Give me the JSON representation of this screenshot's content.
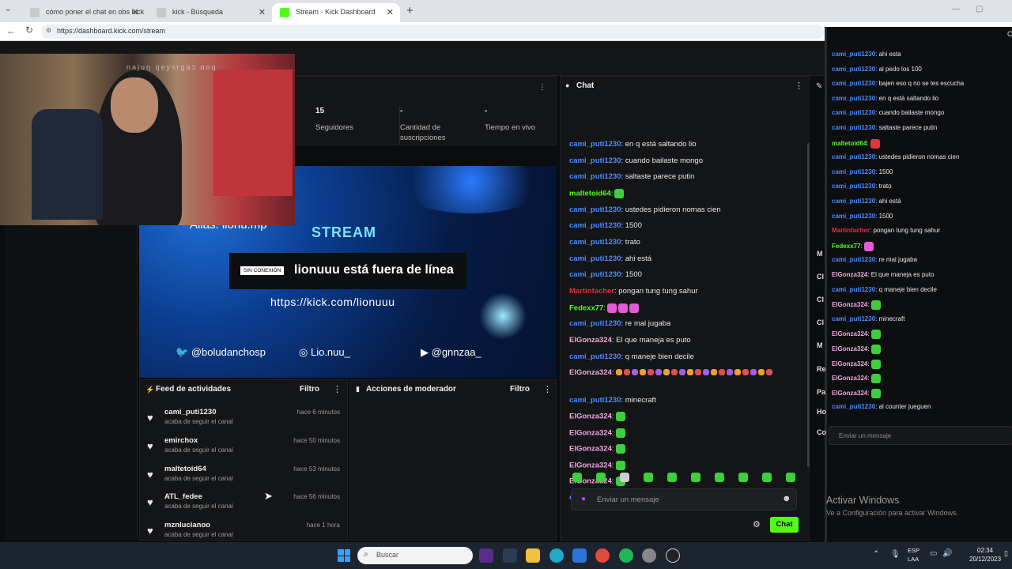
{
  "browser": {
    "tabs": [
      {
        "label": "cómo poner el chat en obs kick - B"
      },
      {
        "label": "kick - Búsqueda"
      },
      {
        "label": "Stream - Kick Dashboard"
      }
    ],
    "url": "https://dashboard.kick.com/stream"
  },
  "stats": [
    {
      "num": "15",
      "label": "Seguidores"
    },
    {
      "num": "-",
      "label": "Cantidad de suscripciones"
    },
    {
      "num": "-",
      "label": "Tiempo en vivo"
    }
  ],
  "banner": {
    "alias": "Alias: lionu.mp",
    "stream_word": "STREAM",
    "offline_badge": "SIN CONEXIÓN",
    "offline_text": "lionuuu está fuera de línea",
    "link": "https://kick.com/lionuuu",
    "social_twitter": "@boludanchosp",
    "social_instagram": "Lio.nuu_",
    "social_youtube": "@gnnzaa_"
  },
  "webcam": {
    "overlay_text": "najuŋ qeysrgaɔ ɑoq"
  },
  "activity_feed": {
    "title": "Feed de actividades",
    "filter": "Filtro",
    "items": [
      {
        "name": "cami_puti1230",
        "desc": "acaba de seguir el canal",
        "time": "hace 6 minutos"
      },
      {
        "name": "emirchox",
        "desc": "acaba de seguir el canal",
        "time": "hace 50 minutos"
      },
      {
        "name": "maltetoid64",
        "desc": "acaba de seguir el canal",
        "time": "hace 53 minutos"
      },
      {
        "name": "ATL_fedee",
        "desc": "acaba de seguir el canal",
        "time": "hace 56 minutos"
      },
      {
        "name": "mznlucianoo",
        "desc": "acaba de seguir el canal",
        "time": "hace 1 hora"
      }
    ]
  },
  "mod_actions": {
    "title": "Acciones de moderador",
    "filter": "Filtro"
  },
  "chat": {
    "title": "Chat",
    "input_placeholder": "Enviar un mensaje",
    "send_label": "Chat",
    "messages": [
      {
        "user": "cami_puti1230",
        "color": "#4a8cff",
        "text": ": en q está saltando lio",
        "emotes": ""
      },
      {
        "user": "cami_puti1230",
        "color": "#4a8cff",
        "text": ": cuando bailaste mongo",
        "emotes": ""
      },
      {
        "user": "cami_puti1230",
        "color": "#4a8cff",
        "text": ": saltaste parece putin",
        "emotes": ""
      },
      {
        "user": "maltetoid64",
        "color": "#53fc18",
        "text": ":",
        "emotes": "g"
      },
      {
        "user": "cami_puti1230",
        "color": "#4a8cff",
        "text": ": ustedes pidieron nomas cien",
        "emotes": ""
      },
      {
        "user": "cami_puti1230",
        "color": "#4a8cff",
        "text": ": 1500",
        "emotes": ""
      },
      {
        "user": "cami_puti1230",
        "color": "#4a8cff",
        "text": ": trato",
        "emotes": ""
      },
      {
        "user": "cami_puti1230",
        "color": "#4a8cff",
        "text": ": ahi está",
        "emotes": ""
      },
      {
        "user": "cami_puti1230",
        "color": "#4a8cff",
        "text": ": 1500",
        "emotes": ""
      },
      {
        "user": "Martinfacher",
        "color": "#e0303c",
        "text": ": pongan tung tung sahur",
        "emotes": ""
      },
      {
        "user": "Fedexx77",
        "color": "#53fc18",
        "text": ":",
        "emotes": "ppp"
      },
      {
        "user": "cami_puti1230",
        "color": "#4a8cff",
        "text": ": re mal jugaba",
        "emotes": ""
      },
      {
        "user": "ElGonza324",
        "color": "#f0a7e0",
        "text": ": El que maneja es puto",
        "emotes": ""
      },
      {
        "user": "cami_puti1230",
        "color": "#4a8cff",
        "text": ": q maneje bien decile",
        "emotes": ""
      },
      {
        "user": "ElGonza324",
        "color": "#f0a7e0",
        "text": ":",
        "emotes": "rrrrrrrrrrrrrrrrrrrr"
      },
      {
        "user": "cami_puti1230",
        "color": "#4a8cff",
        "text": ": minecraft",
        "emotes": ""
      },
      {
        "user": "ElGonza324",
        "color": "#f0a7e0",
        "text": ":",
        "emotes": "g"
      },
      {
        "user": "ElGonza324",
        "color": "#f0a7e0",
        "text": ":",
        "emotes": "g"
      },
      {
        "user": "ElGonza324",
        "color": "#f0a7e0",
        "text": ":",
        "emotes": "g"
      },
      {
        "user": "ElGonza324",
        "color": "#f0a7e0",
        "text": ":",
        "emotes": "g"
      },
      {
        "user": "ElGonza324",
        "color": "#f0a7e0",
        "text": ":",
        "emotes": "g"
      },
      {
        "user": "cami_puti1230",
        "color": "#4a8cff",
        "text": ": al counter jueguen",
        "emotes": ""
      }
    ]
  },
  "popout_chat": {
    "input_placeholder": "Enviar un mensaje",
    "messages": [
      {
        "user": "cami_puti1230",
        "color": "#4a8cff",
        "text": ": ahi esta"
      },
      {
        "user": "cami_puti1230",
        "color": "#4a8cff",
        "text": ": al pedo los 100"
      },
      {
        "user": "cami_puti1230",
        "color": "#4a8cff",
        "text": ": bajen eso q no se les escucha"
      },
      {
        "user": "cami_puti1230",
        "color": "#4a8cff",
        "text": ": en q está saltando lio"
      },
      {
        "user": "cami_puti1230",
        "color": "#4a8cff",
        "text": ": cuando bailaste mongo"
      },
      {
        "user": "cami_puti1230",
        "color": "#4a8cff",
        "text": ": saltaste parece putin"
      },
      {
        "user": "maltetoid64",
        "color": "#53fc18",
        "text": ":"
      },
      {
        "user": "cami_puti1230",
        "color": "#4a8cff",
        "text": ": ustedes pidieron nomas cien"
      },
      {
        "user": "cami_puti1230",
        "color": "#4a8cff",
        "text": ": 1500"
      },
      {
        "user": "cami_puti1230",
        "color": "#4a8cff",
        "text": ": trato"
      },
      {
        "user": "cami_puti1230",
        "color": "#4a8cff",
        "text": ": ahi está"
      },
      {
        "user": "cami_puti1230",
        "color": "#4a8cff",
        "text": ": 1500"
      },
      {
        "user": "Martinfacher",
        "color": "#e0303c",
        "text": ": pongan tung tung sahur"
      },
      {
        "user": "Fedexx77",
        "color": "#53fc18",
        "text": ":"
      },
      {
        "user": "cami_puti1230",
        "color": "#4a8cff",
        "text": ": re mal jugaba"
      },
      {
        "user": "ElGonza324",
        "color": "#f0a7e0",
        "text": ": El que maneja es puto"
      },
      {
        "user": "cami_puti1230",
        "color": "#4a8cff",
        "text": ": q maneje bien decile"
      },
      {
        "user": "ElGonza324",
        "color": "#f0a7e0",
        "text": ":"
      },
      {
        "user": "cami_puti1230",
        "color": "#4a8cff",
        "text": ": minecraft"
      },
      {
        "user": "ElGonza324",
        "color": "#f0a7e0",
        "text": ":"
      },
      {
        "user": "ElGonza324",
        "color": "#f0a7e0",
        "text": ":"
      },
      {
        "user": "ElGonza324",
        "color": "#f0a7e0",
        "text": ":"
      },
      {
        "user": "ElGonza324",
        "color": "#f0a7e0",
        "text": ":"
      },
      {
        "user": "ElGonza324",
        "color": "#f0a7e0",
        "text": ":"
      },
      {
        "user": "cami_puti1230",
        "color": "#4a8cff",
        "text": ": al counter jueguen"
      }
    ],
    "side_letters": [
      "M",
      "Cl",
      "Cl",
      "Cl",
      "M",
      "Re",
      "Pa",
      "Ho",
      "Co"
    ]
  },
  "windows": {
    "activate_title": "Activar Windows",
    "activate_sub": "Ve a Configuración para activar Windows.",
    "search_placeholder": "Buscar",
    "lang": "ESP",
    "lang_sub": "LAA",
    "time": "02:34",
    "date": "20/12/2023"
  },
  "colors": {
    "kick_green": "#53fc18",
    "username_blue": "#4a8cff"
  }
}
